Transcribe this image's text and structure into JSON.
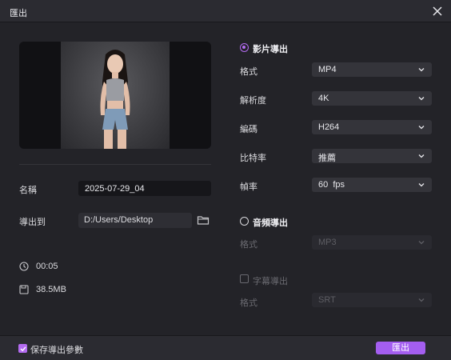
{
  "window": {
    "title": "匯出"
  },
  "left": {
    "name_label": "名稱",
    "name_value": "2025-07-29_04",
    "export_to_label": "導出到",
    "export_path": "D:/Users/Desktop",
    "duration": "00:05",
    "file_size": "38.5MB"
  },
  "video": {
    "title": "影片導出",
    "selected": true,
    "format_label": "格式",
    "format_value": "MP4",
    "resolution_label": "解析度",
    "resolution_value": "4K",
    "codec_label": "編碼",
    "codec_value": "H264",
    "bitrate_label": "比特率",
    "bitrate_value": "推薦",
    "framerate_label": "幀率",
    "framerate_value": "60  fps"
  },
  "audio": {
    "title": "音頻導出",
    "selected": false,
    "format_label": "格式",
    "format_value": "MP3"
  },
  "subtitle": {
    "checkbox_label": "字幕導出",
    "checked": false,
    "format_label": "格式",
    "format_value": "SRT"
  },
  "footer": {
    "save_params_label": "保存導出參數",
    "save_params_checked": true,
    "export_label": "匯出"
  },
  "colors": {
    "accent": "#a45ef0",
    "background": "#232328"
  }
}
